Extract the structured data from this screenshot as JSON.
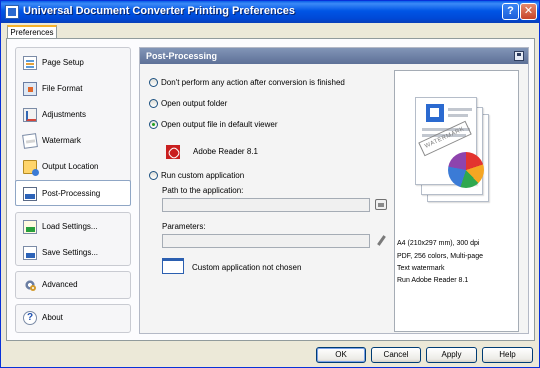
{
  "window": {
    "title": "Universal Document Converter Printing Preferences",
    "help_label": "?",
    "close_label": "✕"
  },
  "tab": {
    "label": "Preferences"
  },
  "nav": {
    "items": [
      {
        "label": "Page Setup",
        "icon": "page-setup-icon"
      },
      {
        "label": "File Format",
        "icon": "file-format-icon"
      },
      {
        "label": "Adjustments",
        "icon": "adjustments-icon"
      },
      {
        "label": "Watermark",
        "icon": "watermark-icon"
      },
      {
        "label": "Output Location",
        "icon": "output-location-icon"
      },
      {
        "label": "Post-Processing",
        "icon": "post-processing-icon",
        "active": true
      }
    ],
    "settings": [
      {
        "label": "Load Settings...",
        "icon": "load-settings-icon"
      },
      {
        "label": "Save Settings...",
        "icon": "save-settings-icon"
      }
    ],
    "advanced": {
      "label": "Advanced",
      "icon": "gears-icon"
    },
    "about": {
      "label": "About",
      "icon": "about-icon",
      "glyph": "?"
    }
  },
  "panel": {
    "title": "Post-Processing",
    "options": {
      "no_action": "Don't perform any action after conversion is finished",
      "open_folder": "Open output folder",
      "open_viewer": "Open output file in default viewer",
      "run_custom": "Run custom application"
    },
    "selected_option": "open_viewer",
    "default_viewer": "Adobe Reader 8.1",
    "path_label": "Path to the application:",
    "path_value": "",
    "params_label": "Parameters:",
    "params_value": "",
    "custom_app_status": "Custom application not chosen"
  },
  "preview": {
    "watermark_text": "WATERMARK",
    "info": [
      "A4 (210x297 mm), 300 dpi",
      "PDF, 256 colors, Multi-page",
      "Text watermark",
      "Run Adobe Reader 8.1"
    ]
  },
  "buttons": {
    "ok": "OK",
    "cancel": "Cancel",
    "apply": "Apply",
    "help": "Help"
  }
}
